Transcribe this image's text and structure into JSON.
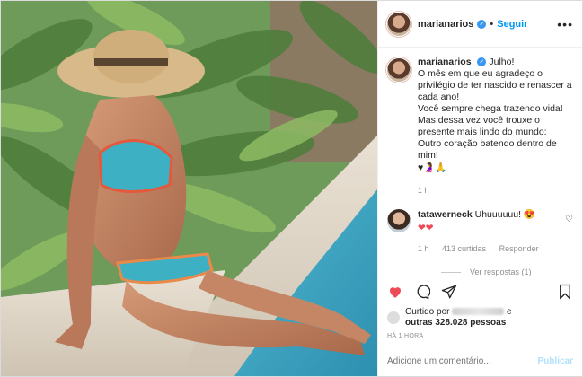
{
  "post": {
    "username": "marianarios",
    "follow_label": "Seguir",
    "separator": "•",
    "more_label": "•••"
  },
  "caption": {
    "username": "marianarios",
    "text": "Julho!\nO mês em que eu agradeço o privilégio de ter nascido e renascer a cada ano!\nVocê sempre chega trazendo vida!\nMas dessa vez você trouxe o presente mais lindo do mundo:\nOutro coração batendo dentro de mim!",
    "emojis": "♥🤰🙏",
    "age": "1 h"
  },
  "reply": {
    "username": "tatawerneck",
    "text": "Uhuuuuuu! 😍",
    "hearts": "❤❤",
    "age": "1 h",
    "likes": "413 curtidas",
    "reply_label": "Responder",
    "view_replies": "Ver respostas (1)"
  },
  "likes": {
    "prefix": "Curtido por",
    "suffix": "e",
    "others": "outras 328.028 pessoas"
  },
  "timestamp": "HÁ 1 HORA",
  "comment_box": {
    "placeholder": "Adicione um comentário...",
    "publish_label": "Publicar"
  },
  "colors": {
    "accent_blue": "#0095f6",
    "heart_red": "#ed4956",
    "publish_disabled": "#b2dffc"
  },
  "icons": {
    "like": "heart-icon",
    "comment": "comment-icon",
    "share": "share-icon",
    "save": "bookmark-icon",
    "verified": "verified-badge-icon"
  }
}
